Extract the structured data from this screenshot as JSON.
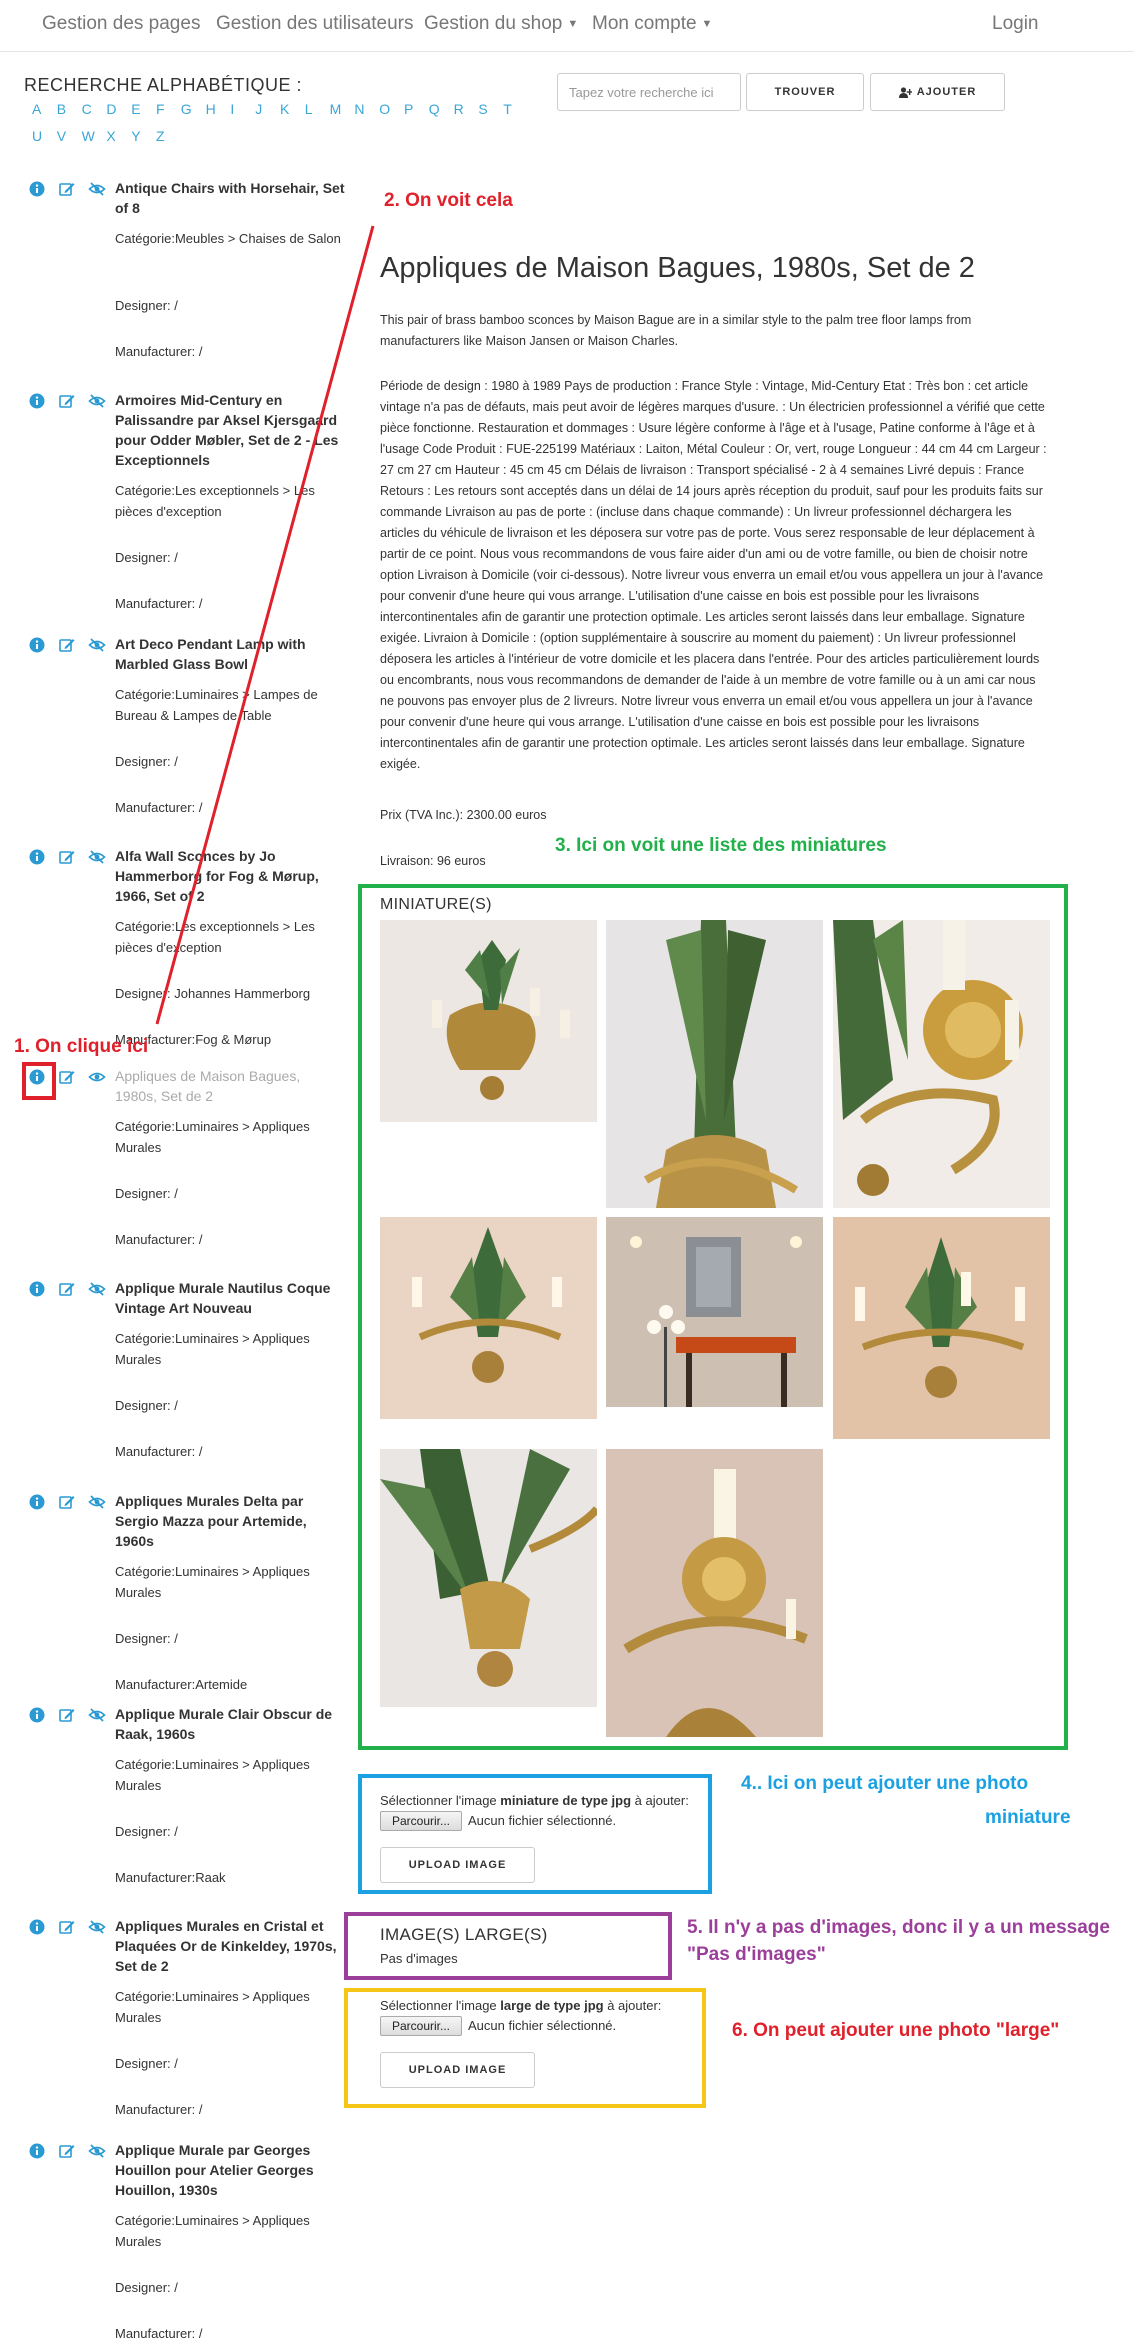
{
  "nav": {
    "items": [
      {
        "label": "Gestion des pages",
        "dropdown": false
      },
      {
        "label": "Gestion des utilisateurs",
        "dropdown": false
      },
      {
        "label": "Gestion du shop",
        "dropdown": true
      },
      {
        "label": "Mon compte",
        "dropdown": true
      }
    ],
    "login": "Login"
  },
  "search": {
    "label": "RECHERCHE ALPHABÉTIQUE :",
    "letters": [
      "A",
      "B",
      "C",
      "D",
      "E",
      "F",
      "G",
      "H",
      "I",
      "J",
      "K",
      "L",
      "M",
      "N",
      "O",
      "P",
      "Q",
      "R",
      "S",
      "T",
      "U",
      "V",
      "W",
      "X",
      "Y",
      "Z"
    ],
    "placeholder": "Tapez votre recherche ici",
    "find_button": "TROUVER",
    "add_button": "AJOUTER"
  },
  "products": [
    {
      "title": "Antique Chairs with Horsehair, Set of 8",
      "category": "Catégorie:Meubles > Chaises de Salon",
      "designer": "Designer: /",
      "manufacturer": "Manufacturer: /",
      "hidden": true
    },
    {
      "title": "Armoires Mid-Century en Palissandre par Aksel Kjersgaard pour Odder Møbler, Set de 2 - Les Exceptionnels",
      "category": "Catégorie:Les exceptionnels > Les pièces d'exception",
      "designer": "Designer: /",
      "manufacturer": "Manufacturer: /",
      "hidden": true
    },
    {
      "title": "Art Deco Pendant Lamp with Marbled Glass Bowl",
      "category": "Catégorie:Luminaires > Lampes de Bureau & Lampes de Table",
      "designer": "Designer: /",
      "manufacturer": "Manufacturer: /",
      "hidden": true
    },
    {
      "title": "Alfa Wall Sconces by Jo Hammerborg for Fog & Mørup, 1966, Set of 2",
      "category": "Catégorie:Les exceptionnels > Les pièces d'exception",
      "designer": "Designer: Johannes Hammerborg",
      "manufacturer": "Manufacturer:Fog & Mørup",
      "hidden": true
    },
    {
      "title": "Appliques de Maison Bagues, 1980s, Set de 2",
      "category": "Catégorie:Luminaires > Appliques Murales",
      "designer": "Designer: /",
      "manufacturer": "Manufacturer: /",
      "hidden": false
    },
    {
      "title": "Applique Murale Nautilus Coque Vintage Art Nouveau",
      "category": "Catégorie:Luminaires > Appliques Murales",
      "designer": "Designer: /",
      "manufacturer": "Manufacturer: /",
      "hidden": true
    },
    {
      "title": "Appliques Murales Delta par Sergio Mazza pour Artemide, 1960s",
      "category": "Catégorie:Luminaires > Appliques Murales",
      "designer": "Designer: /",
      "manufacturer": "Manufacturer:Artemide",
      "hidden": true
    },
    {
      "title": "Applique Murale Clair Obscur de Raak, 1960s",
      "category": "Catégorie:Luminaires > Appliques Murales",
      "designer": "Designer: /",
      "manufacturer": "Manufacturer:Raak",
      "hidden": true
    },
    {
      "title": "Appliques Murales en Cristal et Plaquées Or de Kinkeldey, 1970s, Set de 2",
      "category": "Catégorie:Luminaires > Appliques Murales",
      "designer": "Designer: /",
      "manufacturer": "Manufacturer: /",
      "hidden": true
    },
    {
      "title": "Applique Murale par Georges Houillon pour Atelier Georges Houillon, 1930s",
      "category": "Catégorie:Luminaires > Appliques Murales",
      "designer": "Designer: /",
      "manufacturer": "Manufacturer: /",
      "hidden": true
    }
  ],
  "product": {
    "title": "Appliques de Maison Bagues, 1980s, Set de 2",
    "intro": "This pair of brass bamboo sconces by Maison Bague are in a similar style to the palm tree floor lamps from manufacturers like Maison Jansen or Maison Charles.",
    "description": "Période de design : 1980 à 1989 Pays de production : France Style : Vintage, Mid-Century Etat : Très bon : cet article vintage n'a pas de défauts, mais peut avoir de légères marques d'usure. : Un électricien professionnel a vérifié que cette pièce fonctionne. Restauration et dommages : Usure légère conforme à l'âge et à l'usage, Patine conforme à l'âge et à l'usage Code Produit : FUE-225199 Matériaux : Laiton, Métal Couleur : Or, vert, rouge Longueur : 44 cm 44 cm Largeur : 27 cm 27 cm Hauteur : 45 cm 45 cm Délais de livraison : Transport spécialisé - 2 à 4 semaines Livré depuis : France Retours : Les retours sont acceptés dans un délai de 14 jours après réception du produit, sauf pour les produits faits sur commande Livraison au pas de porte : (incluse dans chaque commande) : Un livreur professionnel déchargera les articles du véhicule de livraison et les déposera sur votre pas de porte. Vous serez responsable de leur déplacement à partir de ce point. Nous vous recommandons de vous faire aider d'un ami ou de votre famille, ou bien de choisir notre option Livraison à Domicile (voir ci-dessous). Notre livreur vous enverra un email et/ou vous appellera un jour à l'avance pour convenir d'une heure qui vous arrange. L'utilisation d'une caisse en bois est possible pour les livraisons intercontinentales afin de garantir une protection optimale. Les articles seront laissés dans leur emballage. Signature exigée. Livraion à Domicile : (option supplémentaire à souscrire au moment du paiement) : Un livreur professionnel déposera les articles à l'intérieur de votre domicile et les placera dans l'entrée. Pour des articles particulièrement lourds ou encombrants, nous vous recommandons de demander de l'aide à un membre de votre famille ou à un ami car nous ne pouvons pas envoyer plus de 2 livreurs. Notre livreur vous enverra un email et/ou vous appellera un jour à l'avance pour convenir d'une heure qui vous arrange. L'utilisation d'une caisse en bois est possible pour les livraisons intercontinentales afin de garantir une protection optimale. Les articles seront laissés dans leur emballage. Signature exigée.",
    "price": "Prix (TVA Inc.): 2300.00 euros",
    "delivery": "Livraison: 96 euros"
  },
  "thumbnails": {
    "label": "MINIATURE(S)"
  },
  "upload_thumb": {
    "text_before": "Sélectionner l'image ",
    "text_bold": "miniature de type jpg",
    "text_after": " à ajouter:",
    "browse": "Parcourir...",
    "no_file": "Aucun fichier sélectionné.",
    "upload_button": "UPLOAD IMAGE"
  },
  "large_images": {
    "label": "IMAGE(S) LARGE(S)",
    "empty": "Pas d'images"
  },
  "upload_large": {
    "text_before": "Sélectionner l'image ",
    "text_bold": "large de type jpg",
    "text_after": " à ajouter:",
    "browse": "Parcourir...",
    "no_file": "Aucun fichier sélectionné.",
    "upload_button": "UPLOAD IMAGE"
  },
  "annotations": {
    "a1": "1. On clique ici",
    "a2": "2. On voit cela",
    "a3": "3. Ici on voit une liste des miniatures",
    "a4_line1": "4.. Ici on peut ajouter une photo",
    "a4_line2": "miniature",
    "a5_line1": "5. Il n'y a pas d'images, donc il y a un message",
    "a5_line2": "\"Pas d'images\"",
    "a6": "6. On peut ajouter une photo \"large\""
  },
  "colors": {
    "link_blue": "#3aa6d6",
    "ann_red": "#e0202a",
    "ann_green": "#22b04b",
    "ann_blue": "#1ba1e2",
    "ann_purple": "#9b3f9a",
    "ann_yellow": "#f5c518"
  }
}
